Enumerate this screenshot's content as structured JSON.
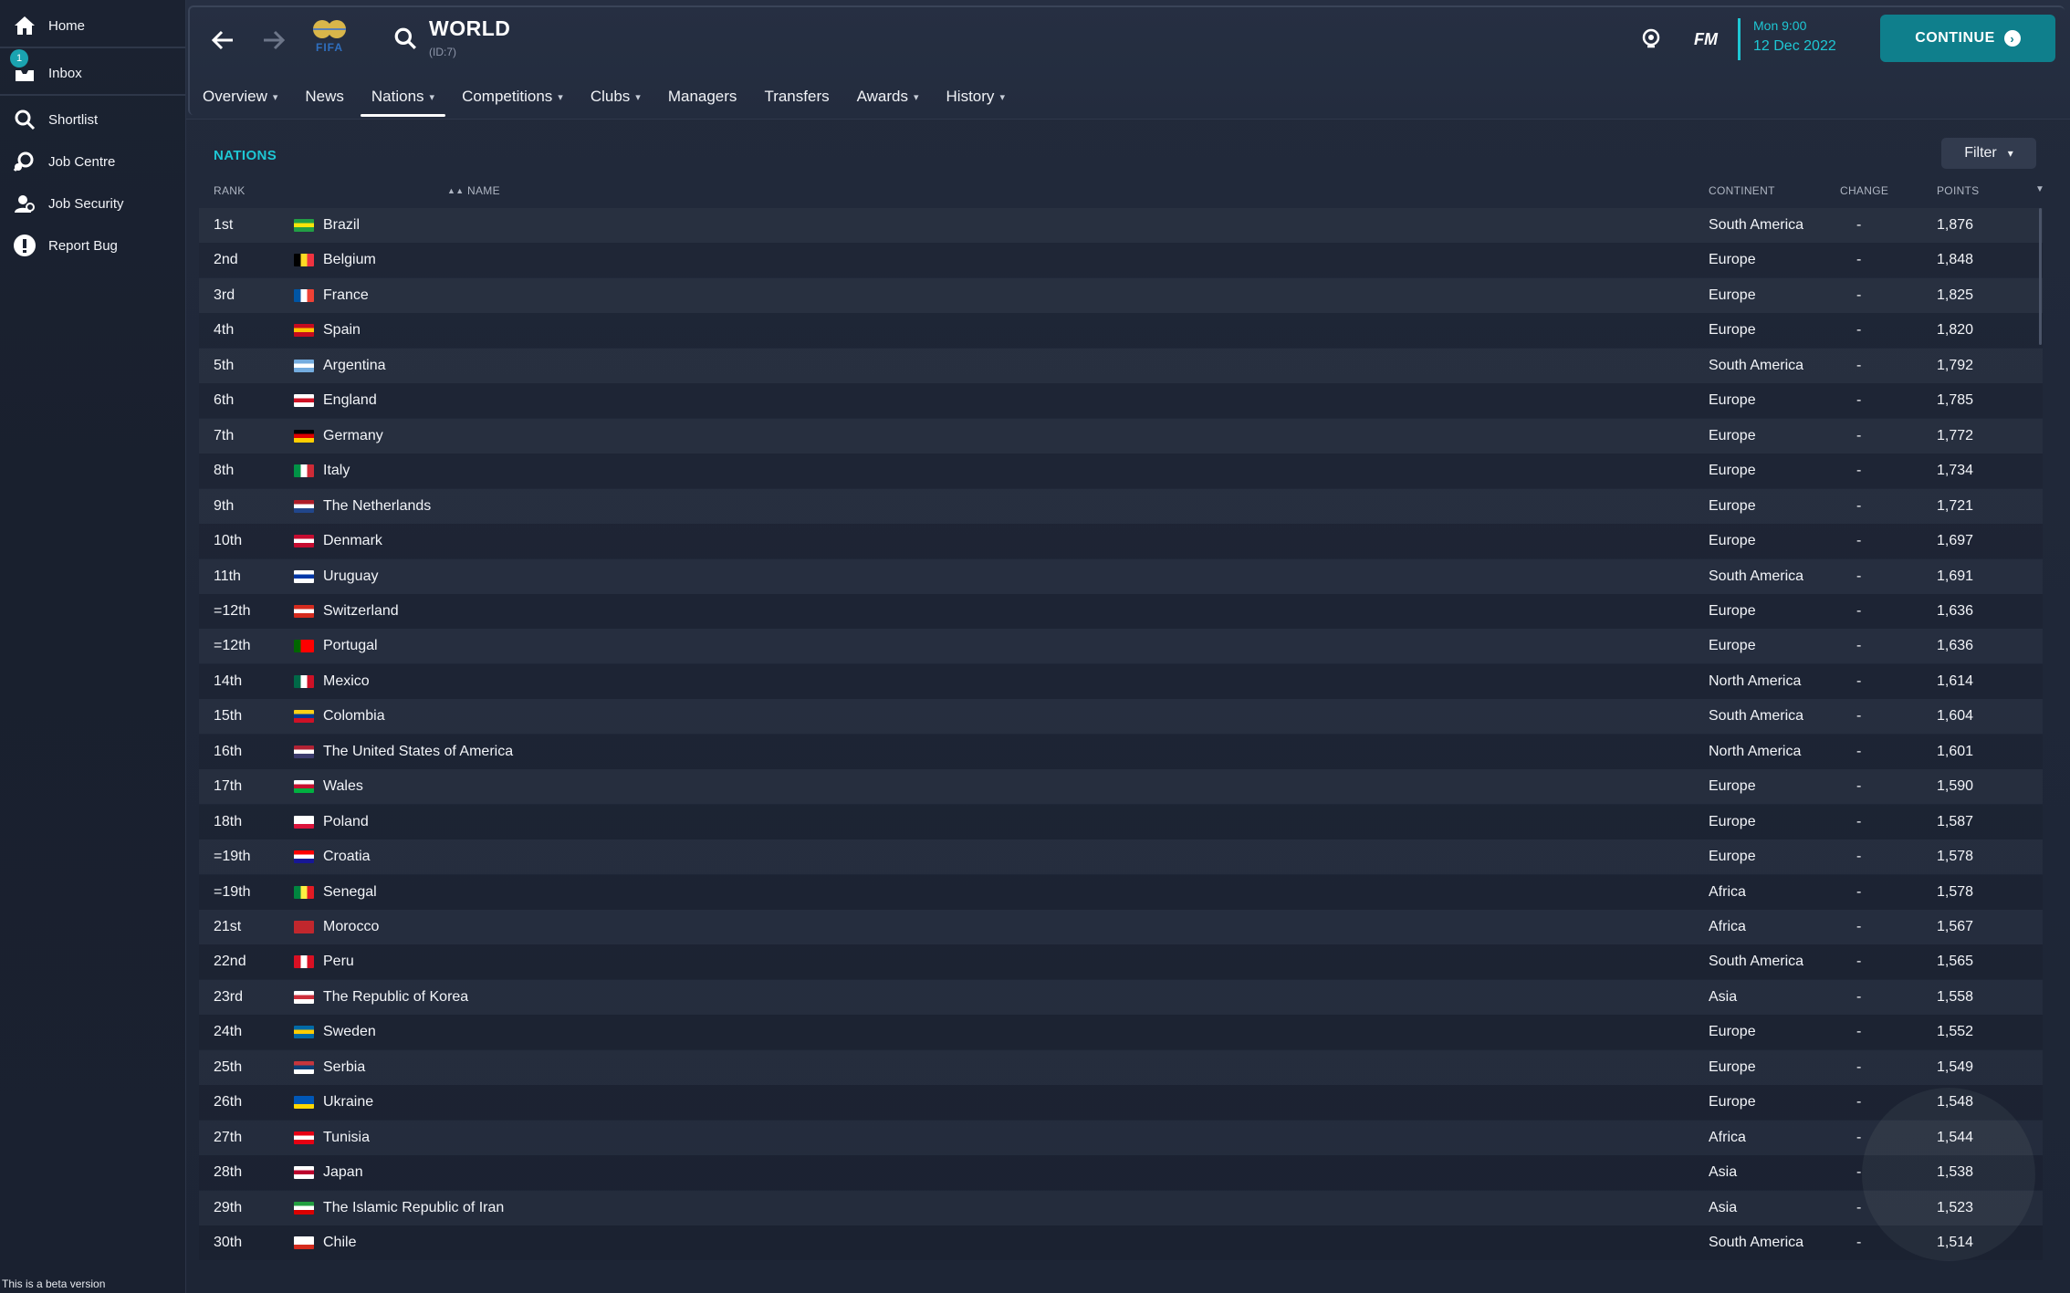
{
  "sidebar": {
    "items": [
      {
        "label": "Home",
        "icon": "home-icon"
      },
      {
        "label": "Inbox",
        "icon": "inbox-icon",
        "badge": "1"
      },
      {
        "label": "Shortlist",
        "icon": "search-icon"
      },
      {
        "label": "Job Centre",
        "icon": "job-centre-icon"
      },
      {
        "label": "Job Security",
        "icon": "job-security-icon"
      },
      {
        "label": "Report Bug",
        "icon": "alert-icon"
      }
    ],
    "beta_note": "This is a beta version"
  },
  "header": {
    "title": "WORLD",
    "subtitle": "(ID:7)",
    "logo_text": "FIFA",
    "brand": "FM",
    "time": "Mon 9:00",
    "date": "12 Dec 2022",
    "continue_label": "CONTINUE",
    "tabs": [
      {
        "label": "Overview",
        "dropdown": true
      },
      {
        "label": "News",
        "dropdown": false
      },
      {
        "label": "Nations",
        "dropdown": true,
        "active": true
      },
      {
        "label": "Competitions",
        "dropdown": true
      },
      {
        "label": "Clubs",
        "dropdown": true
      },
      {
        "label": "Managers",
        "dropdown": false
      },
      {
        "label": "Transfers",
        "dropdown": false
      },
      {
        "label": "Awards",
        "dropdown": true
      },
      {
        "label": "History",
        "dropdown": true
      }
    ]
  },
  "content": {
    "section_title": "NATIONS",
    "filter_label": "Filter",
    "columns": {
      "rank": "RANK",
      "name": "NAME",
      "continent": "CONTINENT",
      "change": "CHANGE",
      "points": "POINTS"
    },
    "rows": [
      {
        "rank": "1st",
        "name": "Brazil",
        "continent": "South America",
        "change": "-",
        "points": "1,876",
        "flag": [
          "#229e45",
          "#f8e509",
          "#229e45"
        ]
      },
      {
        "rank": "2nd",
        "name": "Belgium",
        "continent": "Europe",
        "change": "-",
        "points": "1,848",
        "flag": [
          "#000000",
          "#fdda24",
          "#ef3340"
        ],
        "vertical": true
      },
      {
        "rank": "3rd",
        "name": "France",
        "continent": "Europe",
        "change": "-",
        "points": "1,825",
        "flag": [
          "#0055a4",
          "#ffffff",
          "#ef4135"
        ],
        "vertical": true
      },
      {
        "rank": "4th",
        "name": "Spain",
        "continent": "Europe",
        "change": "-",
        "points": "1,820",
        "flag": [
          "#c60b1e",
          "#ffc400",
          "#c60b1e"
        ]
      },
      {
        "rank": "5th",
        "name": "Argentina",
        "continent": "South America",
        "change": "-",
        "points": "1,792",
        "flag": [
          "#74acdf",
          "#ffffff",
          "#74acdf"
        ]
      },
      {
        "rank": "6th",
        "name": "England",
        "continent": "Europe",
        "change": "-",
        "points": "1,785",
        "flag": [
          "#ffffff",
          "#ce1124",
          "#ffffff"
        ]
      },
      {
        "rank": "7th",
        "name": "Germany",
        "continent": "Europe",
        "change": "-",
        "points": "1,772",
        "flag": [
          "#000000",
          "#dd0000",
          "#ffce00"
        ]
      },
      {
        "rank": "8th",
        "name": "Italy",
        "continent": "Europe",
        "change": "-",
        "points": "1,734",
        "flag": [
          "#009246",
          "#ffffff",
          "#ce2b37"
        ],
        "vertical": true
      },
      {
        "rank": "9th",
        "name": "The Netherlands",
        "continent": "Europe",
        "change": "-",
        "points": "1,721",
        "flag": [
          "#ae1c28",
          "#ffffff",
          "#21468b"
        ]
      },
      {
        "rank": "10th",
        "name": "Denmark",
        "continent": "Europe",
        "change": "-",
        "points": "1,697",
        "flag": [
          "#c60c30",
          "#ffffff",
          "#c60c30"
        ]
      },
      {
        "rank": "11th",
        "name": "Uruguay",
        "continent": "South America",
        "change": "-",
        "points": "1,691",
        "flag": [
          "#ffffff",
          "#0038a8",
          "#ffffff"
        ]
      },
      {
        "rank": "=12th",
        "name": "Switzerland",
        "continent": "Europe",
        "change": "-",
        "points": "1,636",
        "flag": [
          "#d52b1e",
          "#ffffff",
          "#d52b1e"
        ]
      },
      {
        "rank": "=12th",
        "name": "Portugal",
        "continent": "Europe",
        "change": "-",
        "points": "1,636",
        "flag": [
          "#006600",
          "#ff0000",
          "#ff0000"
        ],
        "vertical": true
      },
      {
        "rank": "14th",
        "name": "Mexico",
        "continent": "North America",
        "change": "-",
        "points": "1,614",
        "flag": [
          "#006847",
          "#ffffff",
          "#ce1126"
        ],
        "vertical": true
      },
      {
        "rank": "15th",
        "name": "Colombia",
        "continent": "South America",
        "change": "-",
        "points": "1,604",
        "flag": [
          "#fcd116",
          "#003893",
          "#ce1126"
        ]
      },
      {
        "rank": "16th",
        "name": "The United States of America",
        "continent": "North America",
        "change": "-",
        "points": "1,601",
        "flag": [
          "#b22234",
          "#ffffff",
          "#3c3b6e"
        ]
      },
      {
        "rank": "17th",
        "name": "Wales",
        "continent": "Europe",
        "change": "-",
        "points": "1,590",
        "flag": [
          "#ffffff",
          "#c8102e",
          "#00b140"
        ]
      },
      {
        "rank": "18th",
        "name": "Poland",
        "continent": "Europe",
        "change": "-",
        "points": "1,587",
        "flag": [
          "#ffffff",
          "#ffffff",
          "#dc143c"
        ]
      },
      {
        "rank": "=19th",
        "name": "Croatia",
        "continent": "Europe",
        "change": "-",
        "points": "1,578",
        "flag": [
          "#ff0000",
          "#ffffff",
          "#171796"
        ]
      },
      {
        "rank": "=19th",
        "name": "Senegal",
        "continent": "Africa",
        "change": "-",
        "points": "1,578",
        "flag": [
          "#00853f",
          "#fdef42",
          "#e31b23"
        ],
        "vertical": true
      },
      {
        "rank": "21st",
        "name": "Morocco",
        "continent": "Africa",
        "change": "-",
        "points": "1,567",
        "flag": [
          "#c1272d",
          "#c1272d",
          "#c1272d"
        ]
      },
      {
        "rank": "22nd",
        "name": "Peru",
        "continent": "South America",
        "change": "-",
        "points": "1,565",
        "flag": [
          "#d91023",
          "#ffffff",
          "#d91023"
        ],
        "vertical": true
      },
      {
        "rank": "23rd",
        "name": "The Republic of Korea",
        "continent": "Asia",
        "change": "-",
        "points": "1,558",
        "flag": [
          "#ffffff",
          "#cd2e3a",
          "#ffffff"
        ]
      },
      {
        "rank": "24th",
        "name": "Sweden",
        "continent": "Europe",
        "change": "-",
        "points": "1,552",
        "flag": [
          "#006aa7",
          "#fecc00",
          "#006aa7"
        ]
      },
      {
        "rank": "25th",
        "name": "Serbia",
        "continent": "Europe",
        "change": "-",
        "points": "1,549",
        "flag": [
          "#c6363c",
          "#0c4076",
          "#ffffff"
        ]
      },
      {
        "rank": "26th",
        "name": "Ukraine",
        "continent": "Europe",
        "change": "-",
        "points": "1,548",
        "flag": [
          "#0057b7",
          "#0057b7",
          "#ffd700"
        ]
      },
      {
        "rank": "27th",
        "name": "Tunisia",
        "continent": "Africa",
        "change": "-",
        "points": "1,544",
        "flag": [
          "#e70013",
          "#ffffff",
          "#e70013"
        ]
      },
      {
        "rank": "28th",
        "name": "Japan",
        "continent": "Asia",
        "change": "-",
        "points": "1,538",
        "flag": [
          "#ffffff",
          "#bc002d",
          "#ffffff"
        ]
      },
      {
        "rank": "29th",
        "name": "The Islamic Republic of Iran",
        "continent": "Asia",
        "change": "-",
        "points": "1,523",
        "flag": [
          "#239f40",
          "#ffffff",
          "#da0000"
        ]
      },
      {
        "rank": "30th",
        "name": "Chile",
        "continent": "South America",
        "change": "-",
        "points": "1,514",
        "flag": [
          "#ffffff",
          "#ffffff",
          "#d52b1e"
        ]
      }
    ]
  },
  "colors": {
    "accent": "#1ec7d4",
    "continue_bg": "#0f7f8c",
    "background": "#1f2738"
  }
}
